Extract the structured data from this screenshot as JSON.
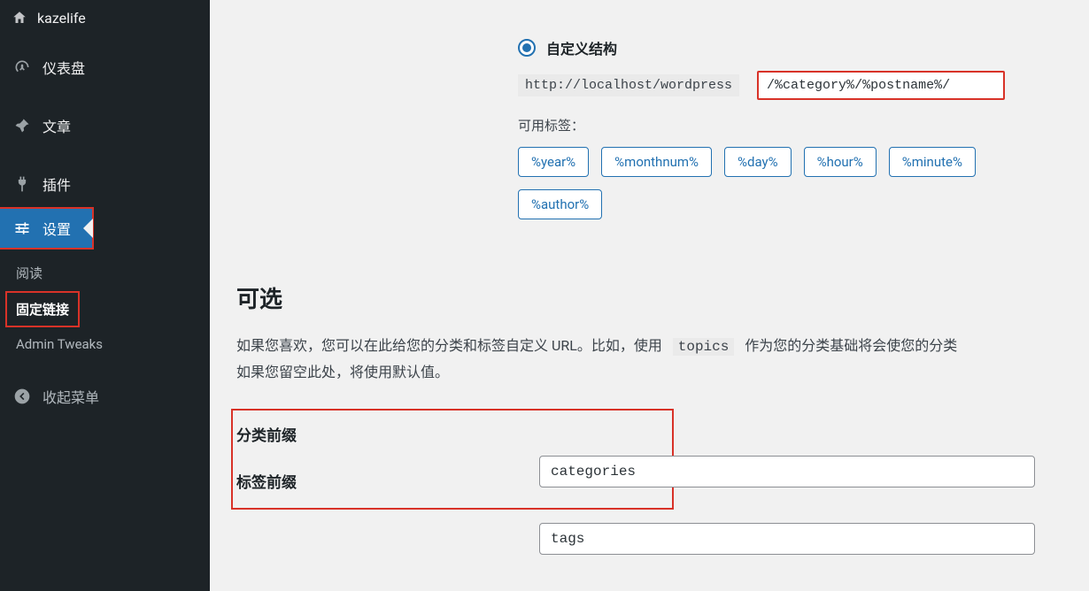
{
  "site_name": "kazelife",
  "sidebar": {
    "items": [
      {
        "label": "仪表盘",
        "icon": "dashboard-icon"
      },
      {
        "label": "文章",
        "icon": "pin-icon"
      },
      {
        "label": "插件",
        "icon": "plug-icon"
      },
      {
        "label": "设置",
        "icon": "sliders-icon"
      }
    ],
    "submenu": [
      {
        "label": "阅读"
      },
      {
        "label": "固定链接"
      },
      {
        "label": "Admin Tweaks"
      }
    ],
    "collapse_label": "收起菜单"
  },
  "permalink": {
    "radio_label": "自定义结构",
    "base_url": "http://localhost/wordpress",
    "custom_value": "/%category%/%postname%/",
    "available_tags_label": "可用标签：",
    "tags_row1": [
      "%year%",
      "%monthnum%",
      "%day%",
      "%hour%",
      "%minute%"
    ],
    "tags_row2": [
      "%author%"
    ]
  },
  "optional": {
    "heading": "可选",
    "desc_before": "如果您喜欢，您可以在此给您的分类和标签自定义 URL。比如，使用",
    "desc_code": "topics",
    "desc_after1": "作为您的分类基础将会使您的分类",
    "desc_line2": "如果您留空此处，将使用默认值。",
    "category_label": "分类前缀",
    "category_value": "categories",
    "tag_label": "标签前缀",
    "tag_value": "tags"
  }
}
